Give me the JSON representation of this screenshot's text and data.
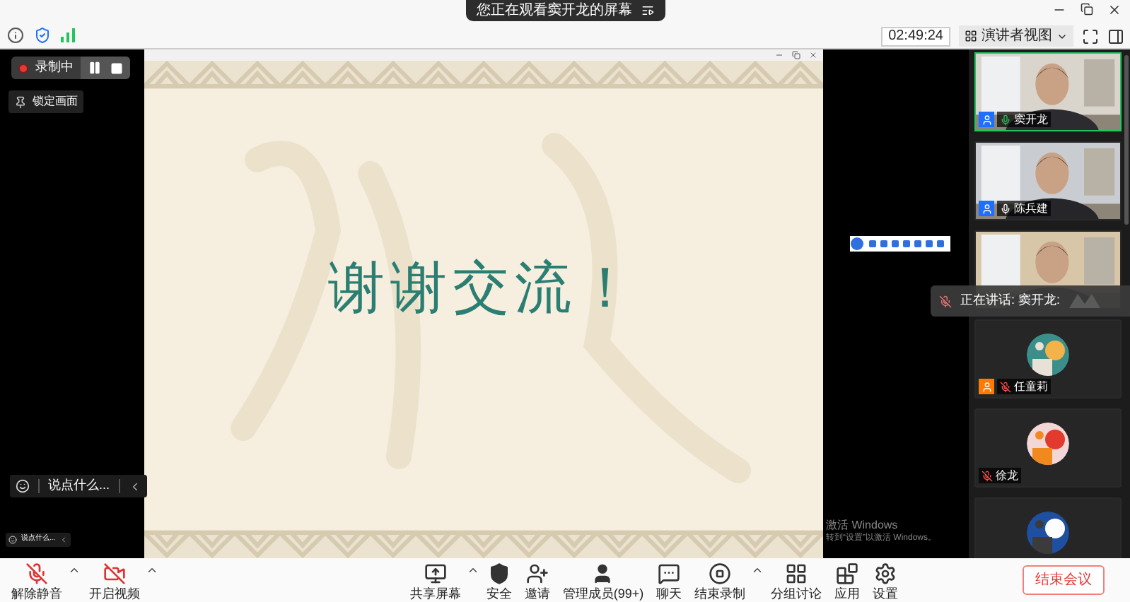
{
  "banner": {
    "text": "您正在观看窦开龙的屏幕"
  },
  "top_bar": {
    "clock": "02:49:24",
    "view_button": "演讲者视图"
  },
  "recording": {
    "label": "录制中"
  },
  "lock_button": {
    "label": "锁定画面"
  },
  "chat_prompts": [
    "说点什么...",
    "说点什么..."
  ],
  "slide": {
    "heading": "谢谢交流！"
  },
  "activation": {
    "title": "激活 Windows",
    "hint": "转到“设置”以激活 Windows。"
  },
  "speaking": {
    "text": "正在讲话: 窦开龙:"
  },
  "participants": [
    {
      "kind": "video",
      "name": "窦开龙",
      "color": "#1e6fff",
      "muted": false,
      "speaking": true
    },
    {
      "kind": "video",
      "name": "陈兵建",
      "color": "#1e6fff",
      "muted": false,
      "speaking": false
    },
    {
      "kind": "video",
      "speaking": false
    },
    {
      "kind": "avatar",
      "name": "任童莉",
      "color": "#ff7a00",
      "muted": true,
      "speaking": false
    },
    {
      "kind": "avatar",
      "name": "徐龙",
      "muted": true,
      "speaking": false
    },
    {
      "kind": "avatar",
      "speaking": false
    }
  ],
  "toolbar": {
    "left": [
      {
        "kind": "mic",
        "label": "解除静音",
        "menu": true
      },
      {
        "kind": "video",
        "label": "开启视频",
        "menu": true
      }
    ],
    "center": [
      {
        "kind": "share",
        "label": "共享屏幕",
        "menu": true
      },
      {
        "kind": "security",
        "label": "安全",
        "menu": false
      },
      {
        "kind": "invite",
        "label": "邀请",
        "menu": false
      },
      {
        "kind": "members",
        "label": "管理成员(99+)",
        "menu": false
      },
      {
        "kind": "chat",
        "label": "聊天",
        "menu": false
      },
      {
        "kind": "record",
        "label": "结束录制",
        "menu": true
      },
      {
        "kind": "breakout",
        "label": "分组讨论",
        "menu": false
      },
      {
        "kind": "apps",
        "label": "应用",
        "menu": false
      },
      {
        "kind": "settings",
        "label": "设置",
        "menu": false
      }
    ],
    "end_button": "结束会议"
  }
}
